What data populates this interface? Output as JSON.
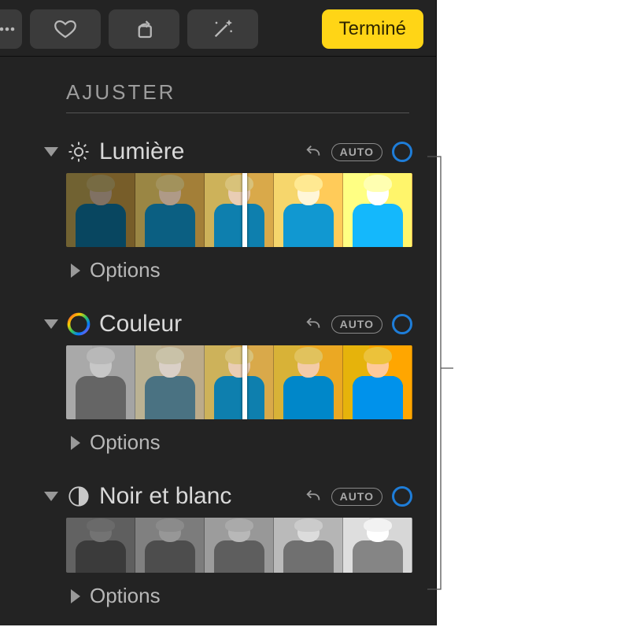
{
  "toolbar": {
    "done_label": "Terminé"
  },
  "adjust": {
    "title": "AJUSTER"
  },
  "sections": {
    "light": {
      "label": "Lumière",
      "auto": "AUTO",
      "options": "Options"
    },
    "color": {
      "label": "Couleur",
      "auto": "AUTO",
      "options": "Options"
    },
    "bw": {
      "label": "Noir et blanc",
      "auto": "AUTO",
      "options": "Options"
    }
  },
  "colors": {
    "accent_ring": "#1e7dd8",
    "done_bg": "#ffd516"
  }
}
